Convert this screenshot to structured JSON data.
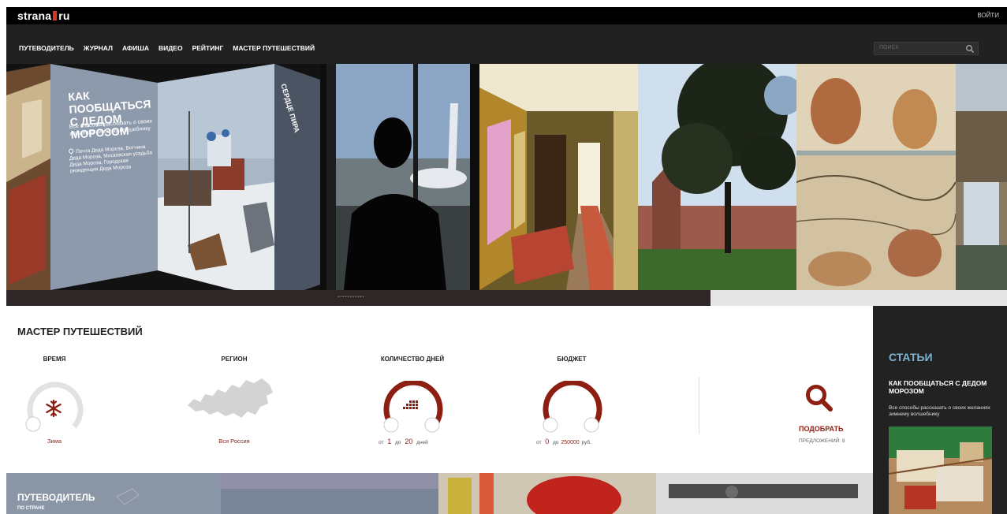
{
  "header": {
    "logo_left": "strana",
    "logo_right": "ru",
    "login": "ВОЙТИ"
  },
  "nav": {
    "items": [
      "ПУТЕВОДИТЕЛЬ",
      "ЖУРНАЛ",
      "АФИША",
      "ВИДЕО",
      "РЕЙТИНГ",
      "МАСТЕР ПУТЕШЕСТВИЙ"
    ],
    "search_placeholder": "ПОИСК"
  },
  "hero": {
    "card_title": "КАК ПООБЩАТЬСЯ С ДЕДОМ МОРОЗОМ",
    "card_desc": "Все способы рассказать о своих желаниях зимнему волшебнику",
    "card_location": "Почта Деда Мороза, Вотчина Деда Мороза, Московская усадьба Деда Мороза, Городская резиденция Деда Мороза",
    "side_title": "СЕРДЦЕ ПИРА",
    "pager": "▪▪▪▪▪▪▪▪▪▪▪"
  },
  "wizard": {
    "title": "МАСТЕР ПУТЕШЕСТВИЙ",
    "time": {
      "label": "ВРЕМЯ",
      "value": "Зима"
    },
    "region": {
      "label": "РЕГИОН",
      "value": "Вся Россия"
    },
    "days": {
      "label": "КОЛИЧЕСТВО ДНЕЙ",
      "from_label": "от",
      "from": "1",
      "to_label": "до",
      "to": "20",
      "unit": "дней"
    },
    "budget": {
      "label": "БЮДЖЕТ",
      "from_label": "от",
      "from": "0",
      "to_label": "до",
      "to": "250000",
      "unit": "руб."
    },
    "find_label": "ПОДОБРАТЬ",
    "offers": "ПРЕДЛОЖЕНИЙ: 8"
  },
  "bottom": {
    "guide_title": "ПУТЕВОДИТЕЛЬ",
    "guide_sub": "ПО СТРАНЕ"
  },
  "sidebar": {
    "heading": "СТАТЬИ",
    "article_title": "КАК ПООБЩАТЬСЯ С ДЕДОМ МОРОЗОМ",
    "article_desc": "Все способы рассказать о своих желаниях зимнему волшебнику"
  },
  "colors": {
    "accent": "#8c1f12",
    "top_bar": "#000000",
    "nav_bg": "#212121",
    "sidebar_heading": "#7fb3d0"
  }
}
